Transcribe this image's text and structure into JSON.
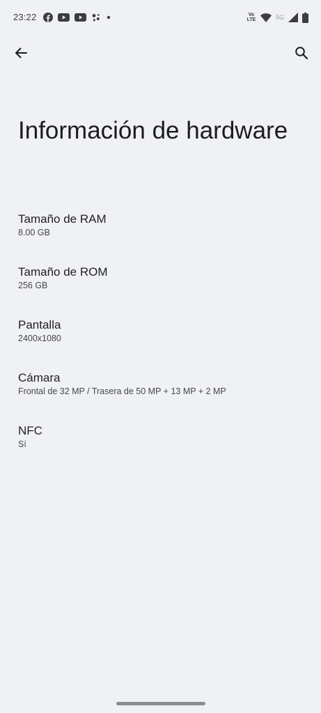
{
  "status_bar": {
    "time": "23:22",
    "left_icons": [
      "facebook-icon",
      "youtube-icon",
      "youtube-icon",
      "assistant-icon",
      "more-dot-icon"
    ],
    "volte_line1": "Vo",
    "volte_line2": "LTE",
    "network_label": "5G",
    "right_icons": [
      "wifi-icon",
      "cellular-signal-icon",
      "battery-icon"
    ]
  },
  "toolbar": {
    "back_icon": "arrow-back-icon",
    "search_icon": "search-icon"
  },
  "page": {
    "title": "Información de hardware"
  },
  "items": [
    {
      "label": "Tamaño de RAM",
      "value": "8.00 GB"
    },
    {
      "label": "Tamaño de ROM",
      "value": "256 GB"
    },
    {
      "label": "Pantalla",
      "value": "2400x1080"
    },
    {
      "label": "Cámara",
      "value": "Frontal de 32 MP / Trasera de 50 MP + 13 MP + 2 MP"
    },
    {
      "label": "NFC",
      "value": "Sí"
    }
  ],
  "colors": {
    "background": "#f0f1f4",
    "text_primary": "#1b1c1f",
    "text_secondary": "#45474b"
  }
}
